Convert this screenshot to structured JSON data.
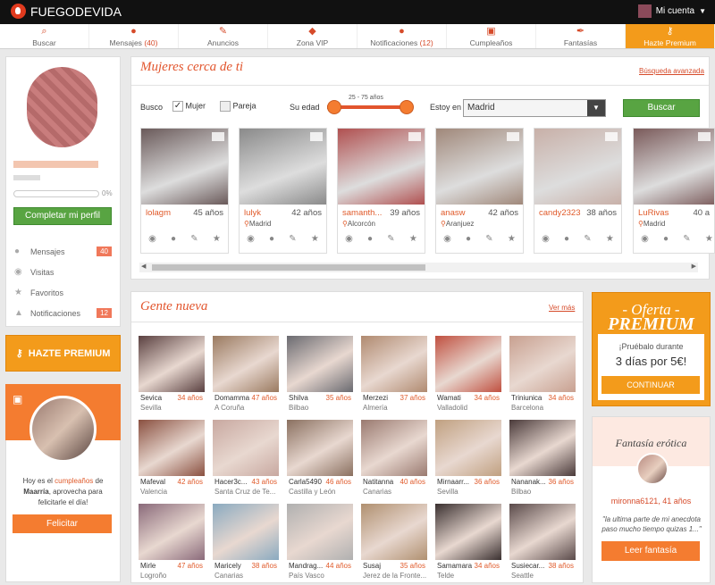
{
  "app": {
    "name": "FUEGODEVIDA",
    "account_label": "Mi cuenta"
  },
  "nav": [
    {
      "label": "Buscar",
      "count": ""
    },
    {
      "label": "Mensajes",
      "count": "(40)"
    },
    {
      "label": "Anuncios",
      "count": ""
    },
    {
      "label": "Zona VIP",
      "count": ""
    },
    {
      "label": "Notificaciones",
      "count": "(12)"
    },
    {
      "label": "Cumpleaños",
      "count": ""
    },
    {
      "label": "Fantasías",
      "count": ""
    },
    {
      "label": "Hazte Premium",
      "count": ""
    }
  ],
  "profile": {
    "progress_pct": "0%",
    "progress_value": 0,
    "complete_label": "Completar mi perfil"
  },
  "sidemenu": [
    {
      "label": "Mensajes",
      "badge": "40",
      "icon": "chat-icon"
    },
    {
      "label": "Visitas",
      "badge": "",
      "icon": "eye-icon"
    },
    {
      "label": "Favoritos",
      "badge": "",
      "icon": "star-icon"
    },
    {
      "label": "Notificaciones",
      "badge": "12",
      "icon": "bell-icon"
    }
  ],
  "hazte_label": "HAZTE PREMIUM",
  "birthday": {
    "pre": "Hoy es el ",
    "highlight": "cumpleaños",
    "post1": " de",
    "name": "Maarría",
    "post2": ", aprovecha para felicitarle el día!",
    "button": "Felicitar"
  },
  "nearby": {
    "title": "Mujeres cerca de ti",
    "adv_link": "Búsqueda avanzada",
    "filter": {
      "busco": "Busco",
      "mujer": "Mujer",
      "pareja": "Pareja",
      "edad": "Su edad",
      "range": "25 - 75 años",
      "estoy": "Estoy en",
      "city": "Madrid",
      "button": "Buscar"
    },
    "profiles": [
      {
        "name": "lolagm",
        "age": "45 años",
        "loc": "",
        "color": "#6a5a5a"
      },
      {
        "name": "lulyk",
        "age": "42 años",
        "loc": "Madrid",
        "color": "#8a8a8a"
      },
      {
        "name": "samanth...",
        "age": "39 años",
        "loc": "Alcorcón",
        "color": "#b05050"
      },
      {
        "name": "anasw",
        "age": "42 años",
        "loc": "Aranjuez",
        "color": "#a0887a"
      },
      {
        "name": "candy2323",
        "age": "38 años",
        "loc": "",
        "color": "#c8b0a8"
      },
      {
        "name": "LuRivas",
        "age": "40 a",
        "loc": "Madrid",
        "color": "#7a5a5a"
      }
    ]
  },
  "newpeople": {
    "title": "Gente nueva",
    "more": "Ver más",
    "rows": [
      [
        {
          "name": "Sevica",
          "age": "34 años",
          "loc": "Sevilla",
          "c": "#5a4040"
        },
        {
          "name": "Domamma",
          "age": "47 años",
          "loc": "A Coruña",
          "c": "#9a7a60"
        },
        {
          "name": "Shilva",
          "age": "35 años",
          "loc": "Bilbao",
          "c": "#6a6a70"
        },
        {
          "name": "Merzezi",
          "age": "37 años",
          "loc": "Almería",
          "c": "#b08a70"
        },
        {
          "name": "Wamati",
          "age": "34 años",
          "loc": "Valladolid",
          "c": "#c05040"
        },
        {
          "name": "Triniunica",
          "age": "34 años",
          "loc": "Barcelona",
          "c": "#c8a090"
        }
      ],
      [
        {
          "name": "Mafeval",
          "age": "42 años",
          "loc": "Valencia",
          "c": "#8a5040"
        },
        {
          "name": "Hacer3c...",
          "age": "43 años",
          "loc": "Santa Cruz de Te...",
          "c": "#c8a8a0"
        },
        {
          "name": "Carla5490",
          "age": "46 años",
          "loc": "Castilla y León",
          "c": "#8a7060"
        },
        {
          "name": "Natitanna",
          "age": "40 años",
          "loc": "Canarias",
          "c": "#9a7a70"
        },
        {
          "name": "Mirnaarr...",
          "age": "36 años",
          "loc": "Sevilla",
          "c": "#c0a080"
        },
        {
          "name": "Nananak...",
          "age": "36 años",
          "loc": "Bilbao",
          "c": "#4a3a3a"
        }
      ],
      [
        {
          "name": "Mirle",
          "age": "47 años",
          "loc": "Logroño",
          "c": "#8a6a7a"
        },
        {
          "name": "Maricely",
          "age": "38 años",
          "loc": "Canarias",
          "c": "#8aaac0"
        },
        {
          "name": "Mandrag...",
          "age": "44 años",
          "loc": "País Vasco",
          "c": "#b0b0b0"
        },
        {
          "name": "Susaj",
          "age": "35 años",
          "loc": "Jerez de la Fronte...",
          "c": "#b09070"
        },
        {
          "name": "Samamara",
          "age": "34 años",
          "loc": "Telde",
          "c": "#3a3030"
        },
        {
          "name": "Susiecar...",
          "age": "38 años",
          "loc": "Seattle",
          "c": "#5a4a4a"
        }
      ]
    ]
  },
  "offer": {
    "line1": "- Oferta -",
    "line2": "PREMIUM",
    "line3": "¡Pruébalo durante",
    "line4": "3 días por 5€!",
    "button": "CONTINUAR"
  },
  "fantasy": {
    "title": "Fantasía erótica",
    "user": "mironna6121, 41 años",
    "quote": "\"la ultima parte de mi anecdota paso mucho tiempo quizas 1...\"",
    "button": "Leer fantasía"
  }
}
